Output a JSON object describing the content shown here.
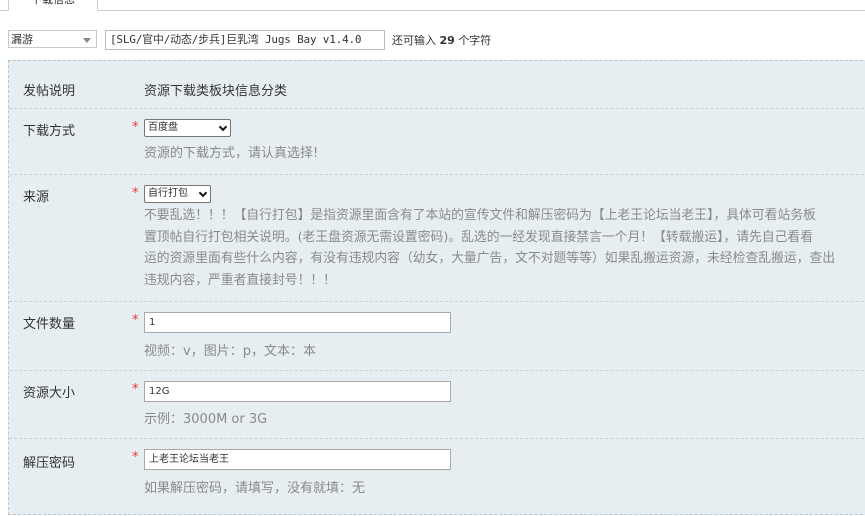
{
  "tab": {
    "label": "下载信息"
  },
  "title_row": {
    "type_select": "漏游",
    "title_value": "[SLG/官中/动态/步兵]巨乳湾 Jugs Bay v1.4.0",
    "remaining_prefix": "还可输入",
    "remaining_count": "29",
    "remaining_suffix": "个字符"
  },
  "form": {
    "intro": {
      "label": "发帖说明",
      "value": "资源下载类板块信息分类"
    },
    "download_method": {
      "label": "下载方式",
      "required": "*",
      "selected": "百度盘",
      "hint": "资源的下载方式，请认真选择!"
    },
    "source": {
      "label": "来源",
      "required": "*",
      "selected": "自行打包",
      "desc_lines": [
        "不要乱选！！！【自行打包】是指资源里面含有了本站的宣传文件和解压密码为【上老王论坛当老王】，具体可看站务板",
        "置顶帖自行打包相关说明。(老王盘资源无需设置密码)。乱选的一经发现直接禁言一个月！【转载搬运】，请先自己看看",
        "运的资源里面有些什么内容，有没有违规内容（幼女，大量广告，文不对题等等）如果乱搬运资源，未经检查乱搬运，查出",
        "违规内容，严重者直接封号！！！"
      ]
    },
    "file_count": {
      "label": "文件数量",
      "required": "*",
      "value": "1",
      "hint": "视频：v，图片：p，文本：本"
    },
    "size": {
      "label": "资源大小",
      "required": "*",
      "value": "12G",
      "hint": "示例：3000M or 3G"
    },
    "password": {
      "label": "解压密码",
      "required": "*",
      "value": "上老王论坛当老王",
      "hint": "如果解压密码，请填写，没有就填：无"
    }
  }
}
